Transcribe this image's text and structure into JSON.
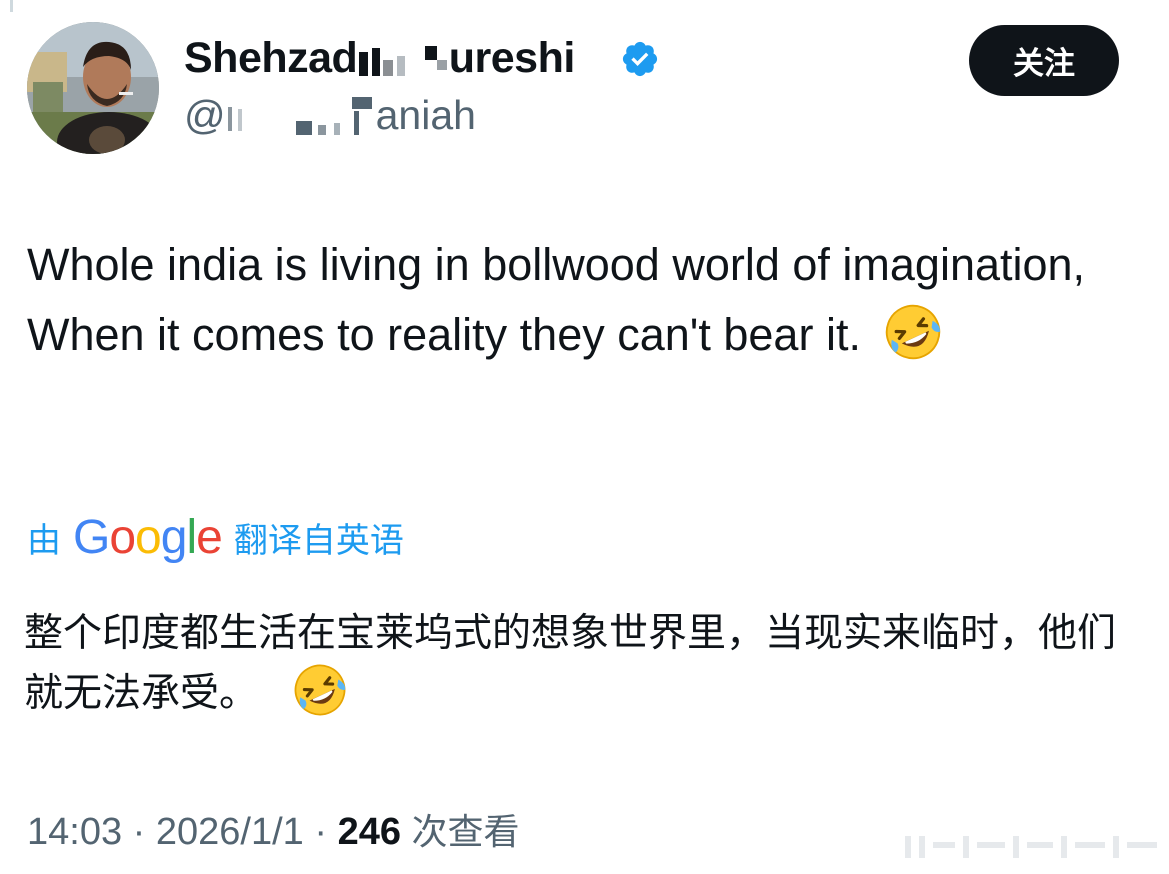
{
  "author": {
    "name_part1": "Shehzad",
    "name_part2": "ureshi",
    "handle_part1": "@",
    "handle_part2": "aniah",
    "verified": true
  },
  "follow_button": {
    "label": "关注"
  },
  "tweet": {
    "text": "Whole india is living in bollwood world of imagination,  When it comes to reality they can't bear it."
  },
  "translation": {
    "prefix": "由",
    "provider": "Google",
    "suffix": "翻译自英语",
    "text": "整个印度都生活在宝莱坞式的想象世界里，当现实来临时，他们就无法承受。"
  },
  "meta": {
    "time": "14:03",
    "date": "2026/1/1",
    "views": "246",
    "views_label": "次查看",
    "separator": "·"
  },
  "colors": {
    "text": "#0f1419",
    "secondary": "#536471",
    "accent": "#1d9bf0",
    "verified_badge": "#1d9bf0"
  },
  "icons": {
    "verified": "verified-badge-icon",
    "emoji": "rolling-on-floor-laughing-emoji"
  }
}
